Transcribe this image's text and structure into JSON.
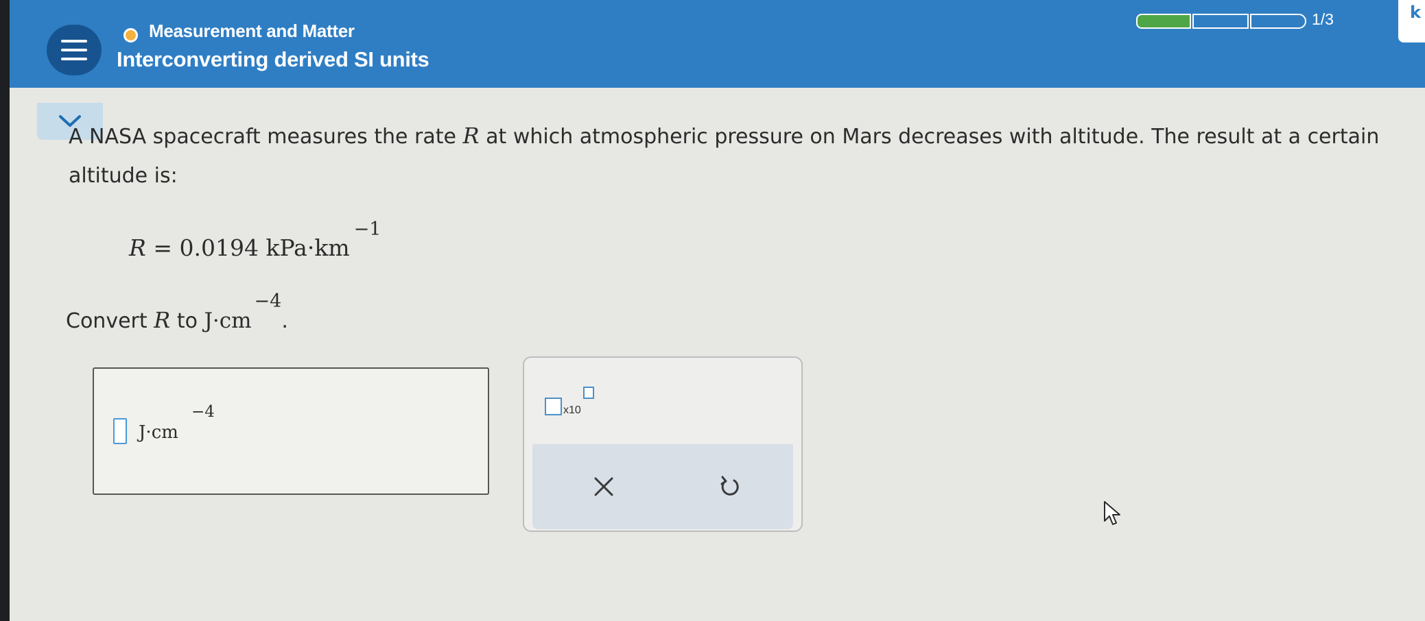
{
  "header": {
    "topic": "Measurement and Matter",
    "title": "Interconverting derived SI units",
    "progress": {
      "label": "1/3",
      "completed": 1,
      "total": 3
    },
    "side_tab_label": "k",
    "colors": {
      "header_bg": "#2f7ec4",
      "topic_dot": "#f3b23e",
      "progress_fill": "#4fa646"
    }
  },
  "icons": {
    "menu": "menu-icon",
    "collapse": "chevron-down-icon",
    "clear": "close-icon",
    "undo": "undo-icon",
    "cursor": "mouse-pointer-icon"
  },
  "question": {
    "intro_before_var": "A NASA spacecraft measures the rate",
    "variable": "R",
    "intro_after_var": "at which atmospheric pressure on Mars decreases with altitude. The result at a certain altitude is:",
    "formula_lhs": "R",
    "formula_rhs": "= 0.0194  kPa·km",
    "formula_exp": "−1",
    "convert_prefix": "Convert",
    "convert_var": "R",
    "convert_to": "to",
    "convert_unit": "J·cm",
    "convert_exp": "−4",
    "convert_suffix": "."
  },
  "answer": {
    "value": "",
    "unit": "J·cm",
    "unit_exp": "−4"
  },
  "tools": {
    "scientific_notation_label": "x10"
  }
}
